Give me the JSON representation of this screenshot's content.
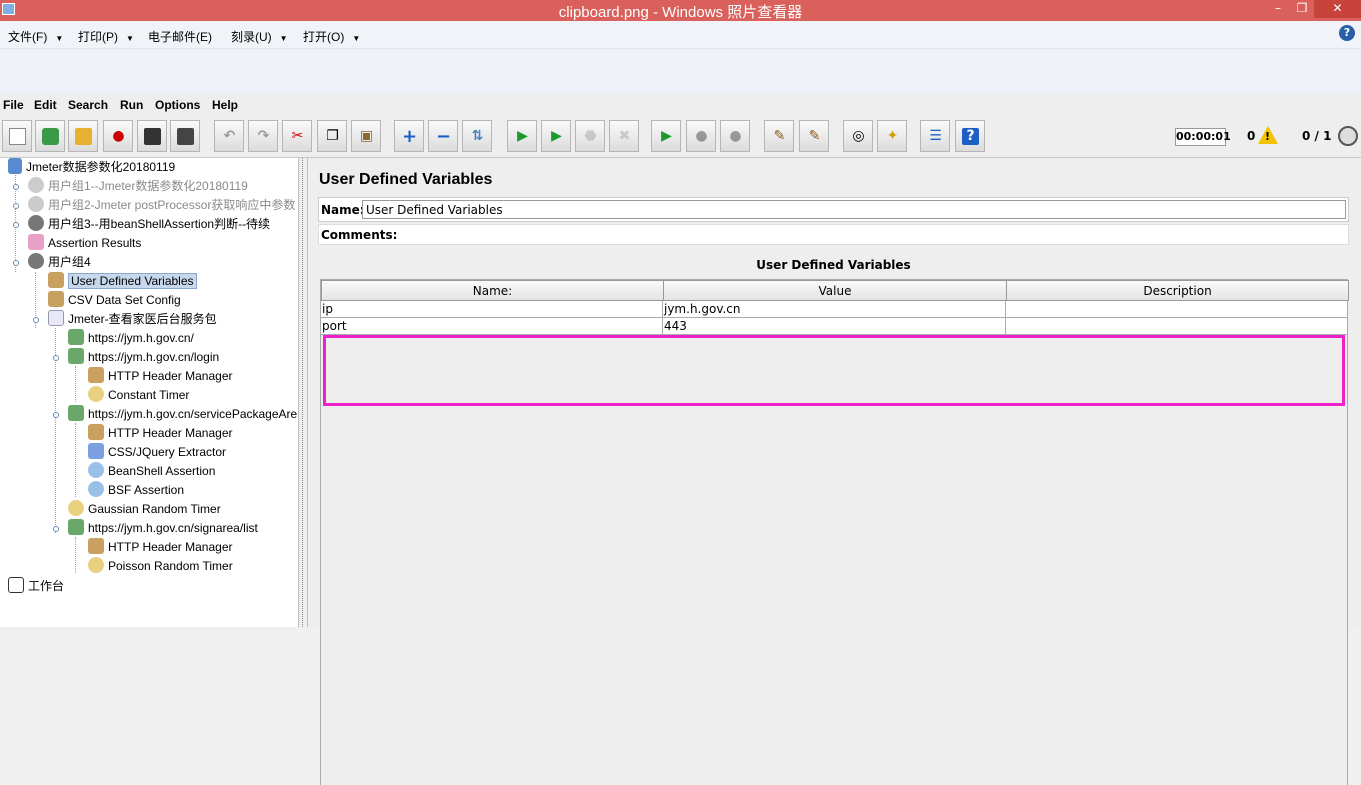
{
  "window": {
    "title": "clipboard.png - Windows 照片查看器",
    "minimize": "–",
    "maximize": "❐",
    "close": "✕"
  },
  "viewer_menu": [
    {
      "label": "文件(F)"
    },
    {
      "label": "打印(P)"
    },
    {
      "label": "电子邮件(E)"
    },
    {
      "label": "刻录(U)"
    },
    {
      "label": "打开(O)"
    }
  ],
  "jmeter_menu": [
    "File",
    "Edit",
    "Search",
    "Run",
    "Options",
    "Help"
  ],
  "status": {
    "timer": "00:00:01",
    "errors": "0",
    "threads": "0 / 1"
  },
  "tree": {
    "items": [
      {
        "label": "Jmeter数据参数化20180119"
      },
      {
        "label": "用户组1--Jmeter数据参数化20180119"
      },
      {
        "label": "用户组2-Jmeter postProcessor获取响应中参数"
      },
      {
        "label": "用户组3--用beanShellAssertion判断--待续"
      },
      {
        "label": "Assertion Results"
      },
      {
        "label": "用户组4"
      },
      {
        "label": "User Defined Variables"
      },
      {
        "label": "CSV Data Set Config"
      },
      {
        "label": "Jmeter-查看家医后台服务包"
      },
      {
        "label": "https://jym.h.gov.cn/"
      },
      {
        "label": "https://jym.h.gov.cn/login"
      },
      {
        "label": "HTTP Header Manager"
      },
      {
        "label": "Constant Timer"
      },
      {
        "label": "https://jym.h.gov.cn/servicePackageAre"
      },
      {
        "label": "HTTP Header Manager"
      },
      {
        "label": "CSS/JQuery Extractor"
      },
      {
        "label": "BeanShell Assertion"
      },
      {
        "label": "BSF Assertion"
      },
      {
        "label": "Gaussian Random Timer"
      },
      {
        "label": "https://jym.h.gov.cn/signarea/list"
      },
      {
        "label": "HTTP Header Manager"
      },
      {
        "label": "Poisson Random Timer"
      },
      {
        "label": "工作台"
      }
    ]
  },
  "panel": {
    "title": "User Defined Variables",
    "name_label": "Name:",
    "name_value": "User Defined Variables",
    "comments_label": "Comments:",
    "table_title": "User Defined Variables",
    "columns": [
      "Name:",
      "Value",
      "Description"
    ],
    "rows": [
      {
        "name": "ip",
        "value": "jym.h.gov.cn",
        "description": ""
      },
      {
        "name": "port",
        "value": "443",
        "description": ""
      }
    ]
  },
  "colors": {
    "title_bar": "#d9605b",
    "highlight_border": "#ee22cc",
    "selection": "#c7d7ec"
  }
}
